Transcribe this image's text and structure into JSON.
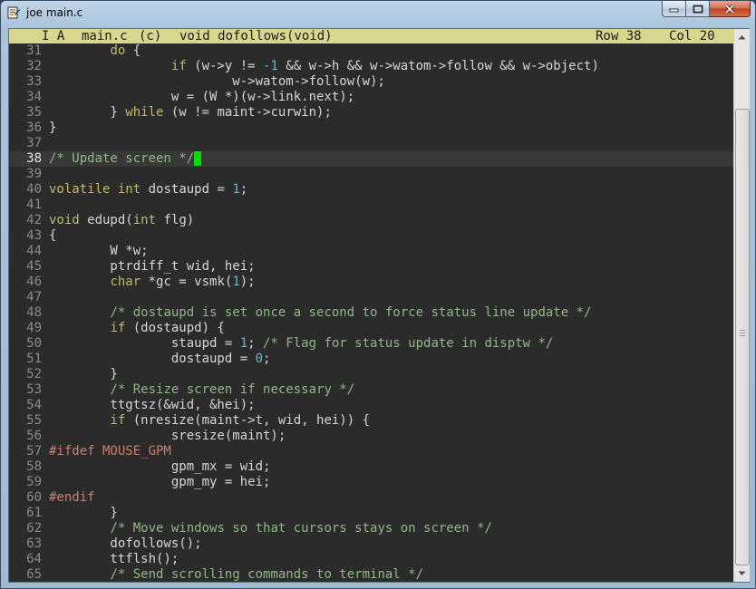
{
  "window": {
    "title": "joe main.c",
    "app_icon": "joe-editor-icon",
    "buttons": {
      "minimize": "minimize-icon",
      "maximize": "maximize-icon",
      "close": "close-icon"
    }
  },
  "status": {
    "mode": "I A",
    "filename": "main.c",
    "filetype": "(c)",
    "context": "void dofollows(void)",
    "row": "Row 38",
    "col": "Col 20"
  },
  "colors": {
    "status_bg": "#d9d78d",
    "editor_bg": "#2b2b2b",
    "keyword": "#c0b96a",
    "number": "#5fb8c9",
    "comment": "#8fb886",
    "preprocessor": "#c8806c",
    "cursor": "#00dd00"
  },
  "current_line": "38",
  "lines": [
    {
      "n": "31",
      "t": [
        [
          "",
          "        "
        ],
        [
          "kw",
          "do"
        ],
        [
          "",
          " {"
        ]
      ]
    },
    {
      "n": "32",
      "t": [
        [
          "",
          "                "
        ],
        [
          "kw",
          "if"
        ],
        [
          "",
          " (w->y != "
        ],
        [
          "num",
          "-1"
        ],
        [
          "",
          " && w->h && w->watom->follow && w->object)"
        ]
      ]
    },
    {
      "n": "33",
      "t": [
        [
          "",
          "                        w->watom->follow(w);"
        ]
      ]
    },
    {
      "n": "34",
      "t": [
        [
          "",
          "                w = (W *)(w->link.next);"
        ]
      ]
    },
    {
      "n": "35",
      "t": [
        [
          "",
          "        } "
        ],
        [
          "kw",
          "while"
        ],
        [
          "",
          " (w != maint->curwin);"
        ]
      ]
    },
    {
      "n": "36",
      "t": [
        [
          "",
          "}"
        ]
      ]
    },
    {
      "n": "37",
      "t": []
    },
    {
      "n": "38",
      "t": [
        [
          "cm",
          "/* Update screen */"
        ]
      ]
    },
    {
      "n": "39",
      "t": []
    },
    {
      "n": "40",
      "t": [
        [
          "kw",
          "volatile"
        ],
        [
          "",
          " "
        ],
        [
          "kw",
          "int"
        ],
        [
          "",
          " dostaupd = "
        ],
        [
          "num",
          "1"
        ],
        [
          "",
          ";"
        ]
      ]
    },
    {
      "n": "41",
      "t": []
    },
    {
      "n": "42",
      "t": [
        [
          "kw",
          "void"
        ],
        [
          "",
          " edupd("
        ],
        [
          "kw",
          "int"
        ],
        [
          "",
          " flg)"
        ]
      ]
    },
    {
      "n": "43",
      "t": [
        [
          "",
          "{"
        ]
      ]
    },
    {
      "n": "44",
      "t": [
        [
          "",
          "        W *w;"
        ]
      ]
    },
    {
      "n": "45",
      "t": [
        [
          "",
          "        ptrdiff_t wid, hei;"
        ]
      ]
    },
    {
      "n": "46",
      "t": [
        [
          "",
          "        "
        ],
        [
          "kw",
          "char"
        ],
        [
          "",
          " *gc = vsmk("
        ],
        [
          "num",
          "1"
        ],
        [
          "",
          ");"
        ]
      ]
    },
    {
      "n": "47",
      "t": []
    },
    {
      "n": "48",
      "t": [
        [
          "",
          "        "
        ],
        [
          "cm",
          "/* dostaupd is set once a second to force status line update */"
        ]
      ]
    },
    {
      "n": "49",
      "t": [
        [
          "",
          "        "
        ],
        [
          "kw",
          "if"
        ],
        [
          "",
          " (dostaupd) {"
        ]
      ]
    },
    {
      "n": "50",
      "t": [
        [
          "",
          "                staupd = "
        ],
        [
          "num",
          "1"
        ],
        [
          "",
          "; "
        ],
        [
          "cm",
          "/* Flag for status update in disptw */"
        ]
      ]
    },
    {
      "n": "51",
      "t": [
        [
          "",
          "                dostaupd = "
        ],
        [
          "num",
          "0"
        ],
        [
          "",
          ";"
        ]
      ]
    },
    {
      "n": "52",
      "t": [
        [
          "",
          "        }"
        ]
      ]
    },
    {
      "n": "53",
      "t": [
        [
          "",
          "        "
        ],
        [
          "cm",
          "/* Resize screen if necessary */"
        ]
      ]
    },
    {
      "n": "54",
      "t": [
        [
          "",
          "        ttgtsz(&wid, &hei);"
        ]
      ]
    },
    {
      "n": "55",
      "t": [
        [
          "",
          "        "
        ],
        [
          "kw",
          "if"
        ],
        [
          "",
          " (nresize(maint->t, wid, hei)) {"
        ]
      ]
    },
    {
      "n": "56",
      "t": [
        [
          "",
          "                sresize(maint);"
        ]
      ]
    },
    {
      "n": "57",
      "t": [
        [
          "pp",
          "#ifdef MOUSE_GPM"
        ]
      ]
    },
    {
      "n": "58",
      "t": [
        [
          "",
          "                gpm_mx = wid;"
        ]
      ]
    },
    {
      "n": "59",
      "t": [
        [
          "",
          "                gpm_my = hei;"
        ]
      ]
    },
    {
      "n": "60",
      "t": [
        [
          "pp",
          "#endif"
        ]
      ]
    },
    {
      "n": "61",
      "t": [
        [
          "",
          "        }"
        ]
      ]
    },
    {
      "n": "62",
      "t": [
        [
          "",
          "        "
        ],
        [
          "cm",
          "/* Move windows so that cursors stays on screen */"
        ]
      ]
    },
    {
      "n": "63",
      "t": [
        [
          "",
          "        dofollows();"
        ]
      ]
    },
    {
      "n": "64",
      "t": [
        [
          "",
          "        ttflsh();"
        ]
      ]
    },
    {
      "n": "65",
      "t": [
        [
          "",
          "        "
        ],
        [
          "cm",
          "/* Send scrolling commands to terminal */"
        ]
      ]
    }
  ],
  "scrollbar": {
    "up_icon": "scroll-up-arrow-icon",
    "down_icon": "scroll-down-arrow-icon"
  }
}
